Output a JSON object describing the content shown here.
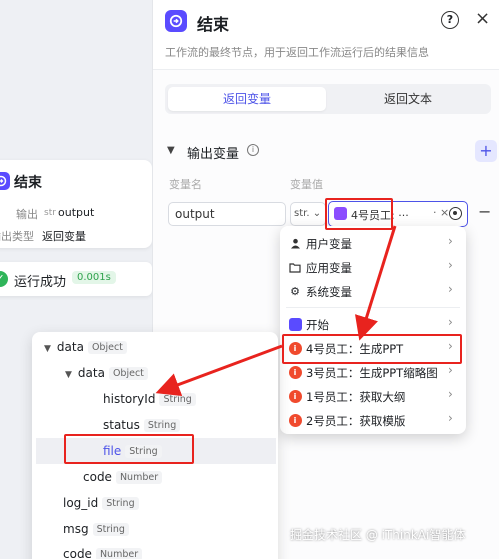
{
  "canvas_node": {
    "title": "结束",
    "row1_label": "输出",
    "row1_tag": "str",
    "row1_value": "output",
    "row2_label": "输出类型",
    "row2_value": "返回变量"
  },
  "canvas_status": {
    "text": "运行成功",
    "time": "0.001s"
  },
  "panel": {
    "title": "结束",
    "description": "工作流的最终节点，用于返回工作流运行后的结果信息",
    "help": "?",
    "close": "×",
    "tabs": [
      {
        "label": "返回变量",
        "active": true
      },
      {
        "label": "返回文本",
        "active": false
      }
    ],
    "section_title": "输出变量",
    "add": "+",
    "col_name": "变量名",
    "col_value": "变量值",
    "row": {
      "name": "output",
      "type": "str.",
      "value": "4号员工: ···",
      "clear": "· ×",
      "remove": "−"
    }
  },
  "dropdown": {
    "items": [
      {
        "label": "用户变量",
        "icon": "user-icon"
      },
      {
        "label": "应用变量",
        "icon": "folder-icon"
      },
      {
        "label": "系统变量",
        "icon": "gear-icon"
      },
      {
        "label": "开始",
        "icon": "start-node-icon"
      },
      {
        "label": "4号员工：生成PPT",
        "icon": "employee-icon"
      },
      {
        "label": "3号员工：生成PPT缩略图",
        "icon": "employee-icon"
      },
      {
        "label": "1号员工：获取大纲",
        "icon": "employee-icon"
      },
      {
        "label": "2号员工：获取模版",
        "icon": "employee-icon"
      }
    ]
  },
  "tree": {
    "rows": [
      {
        "label": "data",
        "tag": "Object"
      },
      {
        "label": "data",
        "tag": "Object"
      },
      {
        "label": "historyId",
        "tag": "String"
      },
      {
        "label": "status",
        "tag": "String"
      },
      {
        "label": "file",
        "tag": "String"
      },
      {
        "label": "code",
        "tag": "Number"
      },
      {
        "label": "log_id",
        "tag": "String"
      },
      {
        "label": "msg",
        "tag": "String"
      },
      {
        "label": "code",
        "tag": "Number"
      }
    ]
  },
  "watermark": "掘金技术社区 @ iThinkAi智能体",
  "colors": {
    "accent": "#4d53e8",
    "highlight_red": "#e8231e",
    "success": "#2fb55a"
  }
}
